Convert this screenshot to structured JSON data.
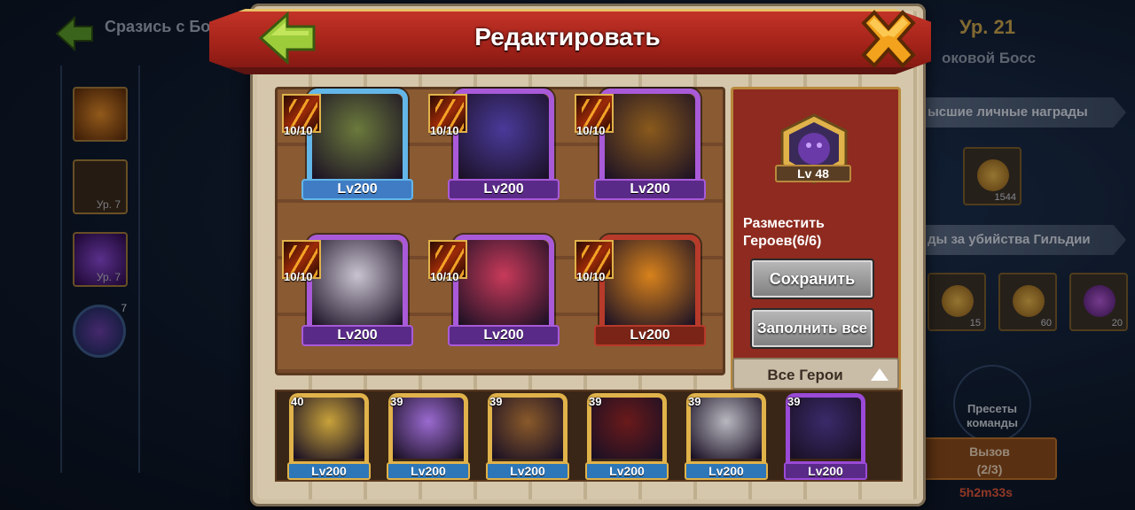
{
  "background": {
    "title": "Сразись с Боссом",
    "level": "Ур. 21",
    "boss_name": "оковой Босс",
    "banner_rewards": "ысшие личные награды",
    "banner_guild": "ды за убийства Гильдии",
    "reward_counts": [
      "1544",
      "15",
      "60",
      "20"
    ],
    "skill_levels": [
      "Ур. 7",
      "Ур. 7"
    ],
    "orb_badge": "7",
    "presets_label": "Пресеты команды",
    "challenge_label": "Вызов",
    "challenge_count": "(2/3)",
    "timer": "5h2m33s"
  },
  "dialog": {
    "title": "Редактировать",
    "boss_level": "Lv 48",
    "place_heroes_label": "Разместить Героев(6/6)",
    "save_button": "Сохранить",
    "fill_all_button": "Заполнить все",
    "filter_label": "Все Герои"
  },
  "team": [
    {
      "level": "Lv200",
      "skill": "10/10",
      "frame": "#63b6e8",
      "bar": "#3f7cc4",
      "color": "#6b7a3c",
      "name": "armored-knight"
    },
    {
      "level": "Lv200",
      "skill": "10/10",
      "frame": "#a85ad8",
      "bar": "#5a2a88",
      "color": "#4a3a9a",
      "name": "horned-demon"
    },
    {
      "level": "Lv200",
      "skill": "10/10",
      "frame": "#a85ad8",
      "bar": "#5a2a88",
      "color": "#8a5a1c",
      "name": "golden-pharaoh"
    },
    {
      "level": "Lv200",
      "skill": "10/10",
      "frame": "#a85ad8",
      "bar": "#5a2a88",
      "color": "#c9c3d0",
      "name": "vampire"
    },
    {
      "level": "Lv200",
      "skill": "10/10",
      "frame": "#a85ad8",
      "bar": "#5a2a88",
      "color": "#c83a5a",
      "name": "fairy"
    },
    {
      "level": "Lv200",
      "skill": "10/10",
      "frame": "#b83a2a",
      "bar": "#7a2418",
      "color": "#d8821c",
      "name": "pumpkin"
    }
  ],
  "roster": [
    {
      "level": "Lv200",
      "star": "40",
      "color": "#c8a23a",
      "purple": false
    },
    {
      "level": "Lv200",
      "star": "39",
      "color": "#9a6ad0",
      "purple": false
    },
    {
      "level": "Lv200",
      "star": "39",
      "color": "#8a5a2a",
      "purple": false
    },
    {
      "level": "Lv200",
      "star": "39",
      "color": "#6a1a1a",
      "purple": false
    },
    {
      "level": "Lv200",
      "star": "39",
      "color": "#b8b8c0",
      "purple": false
    },
    {
      "level": "Lv200",
      "star": "39",
      "color": "#3a2a6a",
      "purple": true
    }
  ]
}
